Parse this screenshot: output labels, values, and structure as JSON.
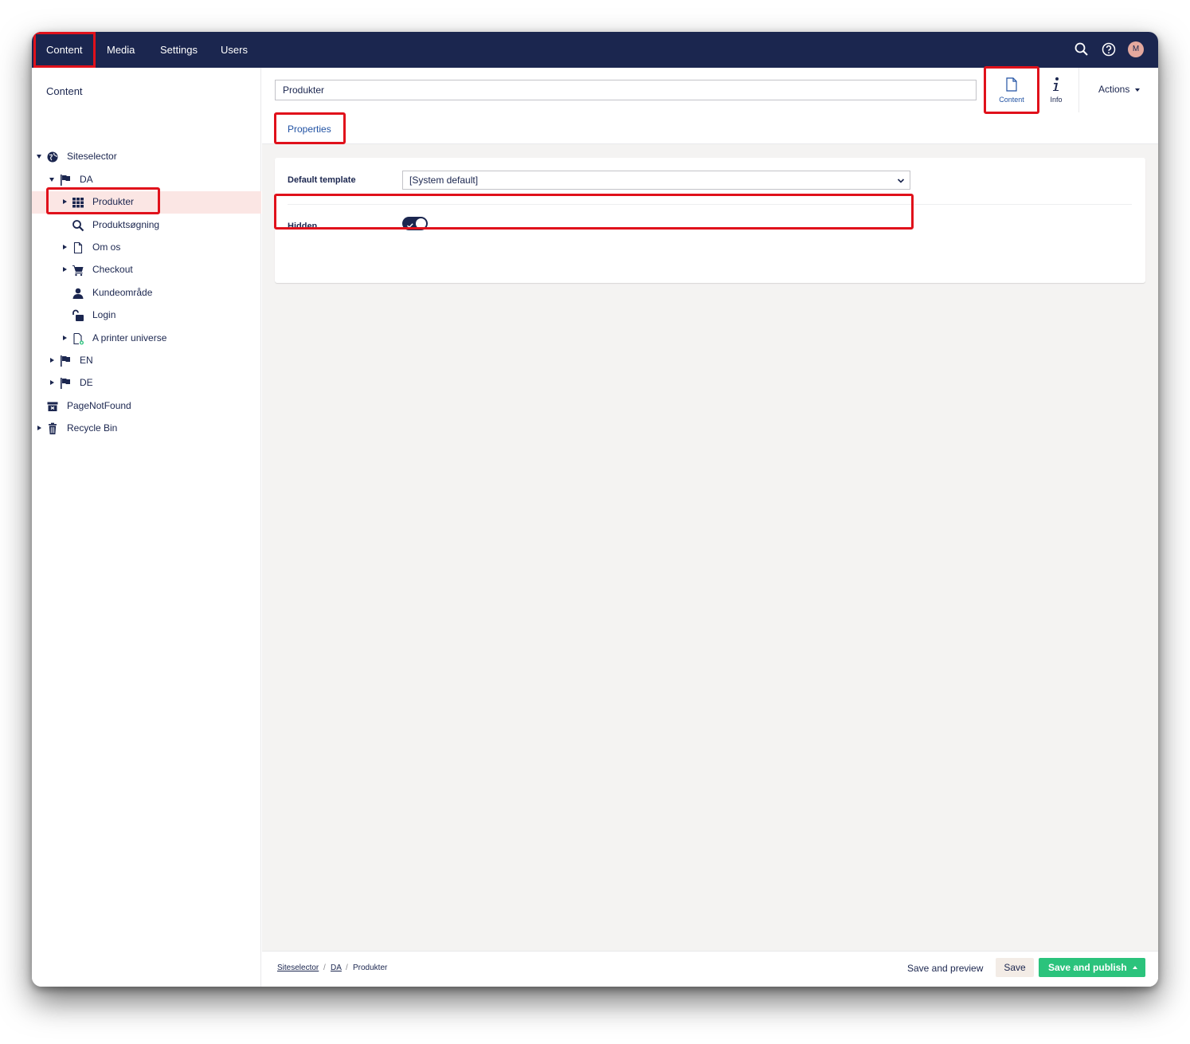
{
  "nav": {
    "items": [
      {
        "label": "Content"
      },
      {
        "label": "Media"
      },
      {
        "label": "Settings"
      },
      {
        "label": "Users"
      }
    ],
    "avatar_initial": "M"
  },
  "sidebar": {
    "title": "Content",
    "tree": [
      {
        "label": "Siteselector",
        "icon": "globe-icon"
      },
      {
        "label": "DA",
        "icon": "flag-icon"
      },
      {
        "label": "Produkter",
        "icon": "grid-icon"
      },
      {
        "label": "Produktsøgning",
        "icon": "search-icon"
      },
      {
        "label": "Om os",
        "icon": "document-icon"
      },
      {
        "label": "Checkout",
        "icon": "cart-icon"
      },
      {
        "label": "Kundeområde",
        "icon": "user-icon"
      },
      {
        "label": "Login",
        "icon": "unlock-icon"
      },
      {
        "label": "A printer universe",
        "icon": "document-add-icon"
      },
      {
        "label": "EN",
        "icon": "flag-icon"
      },
      {
        "label": "DE",
        "icon": "flag-icon"
      },
      {
        "label": "PageNotFound",
        "icon": "archive-icon"
      },
      {
        "label": "Recycle Bin",
        "icon": "trash-icon"
      }
    ]
  },
  "editor": {
    "name_value": "Produkter",
    "apps": [
      {
        "label": "Content",
        "icon": "document-icon"
      },
      {
        "label": "Info",
        "icon": "info-icon"
      }
    ],
    "actions_label": "Actions",
    "tab_label": "Properties",
    "properties": {
      "template_label": "Default template",
      "template_value": "[System default]",
      "hidden_label": "Hidden",
      "hidden_value": true
    }
  },
  "footer": {
    "breadcrumb": [
      "Siteselector",
      "DA",
      "Produkter"
    ],
    "save_preview_label": "Save and preview",
    "save_label": "Save",
    "publish_label": "Save and publish"
  },
  "colors": {
    "topbar": "#1b264f",
    "highlight": "#e0111b",
    "publish": "#2bc37c",
    "selected_row": "#fbe6e4"
  }
}
